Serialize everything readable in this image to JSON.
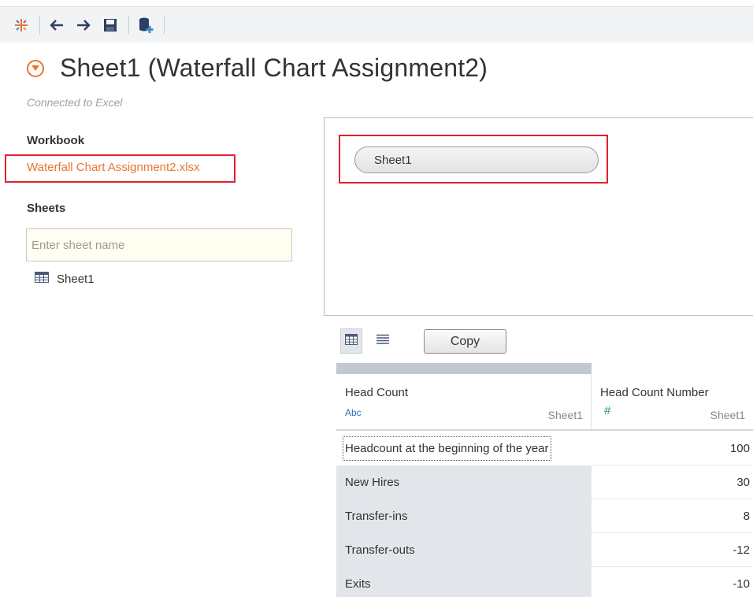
{
  "toolbar": {
    "icons": [
      "tableau-logo-icon",
      "back-arrow-icon",
      "forward-arrow-icon",
      "save-icon",
      "add-datasource-icon"
    ]
  },
  "header": {
    "title": "Sheet1 (Waterfall Chart Assignment2)",
    "subtitle": "Connected to Excel"
  },
  "sidebar": {
    "workbook_heading": "Workbook",
    "workbook_file": "Waterfall Chart Assignment2.xlsx",
    "sheets_heading": "Sheets",
    "search_placeholder": "Enter sheet name",
    "sheets": [
      {
        "label": "Sheet1"
      }
    ]
  },
  "canvas": {
    "pill_label": "Sheet1"
  },
  "grid_controls": {
    "copy_label": "Copy"
  },
  "table": {
    "columns": [
      {
        "name": "Head Count",
        "type": "Abc",
        "source": "Sheet1"
      },
      {
        "name": "Head Count Number",
        "type": "#",
        "source": "Sheet1"
      }
    ],
    "rows": [
      {
        "label": "Headcount at the beginning of the year",
        "value": "100"
      },
      {
        "label": "New Hires",
        "value": "30"
      },
      {
        "label": "Transfer-ins",
        "value": "8"
      },
      {
        "label": "Transfer-outs",
        "value": "-12"
      },
      {
        "label": "Exits",
        "value": "-10"
      }
    ]
  },
  "colors": {
    "accent": "#e8752e",
    "highlight_border": "#e0222d",
    "number_type": "#20a050",
    "string_type": "#2a6ebb"
  }
}
